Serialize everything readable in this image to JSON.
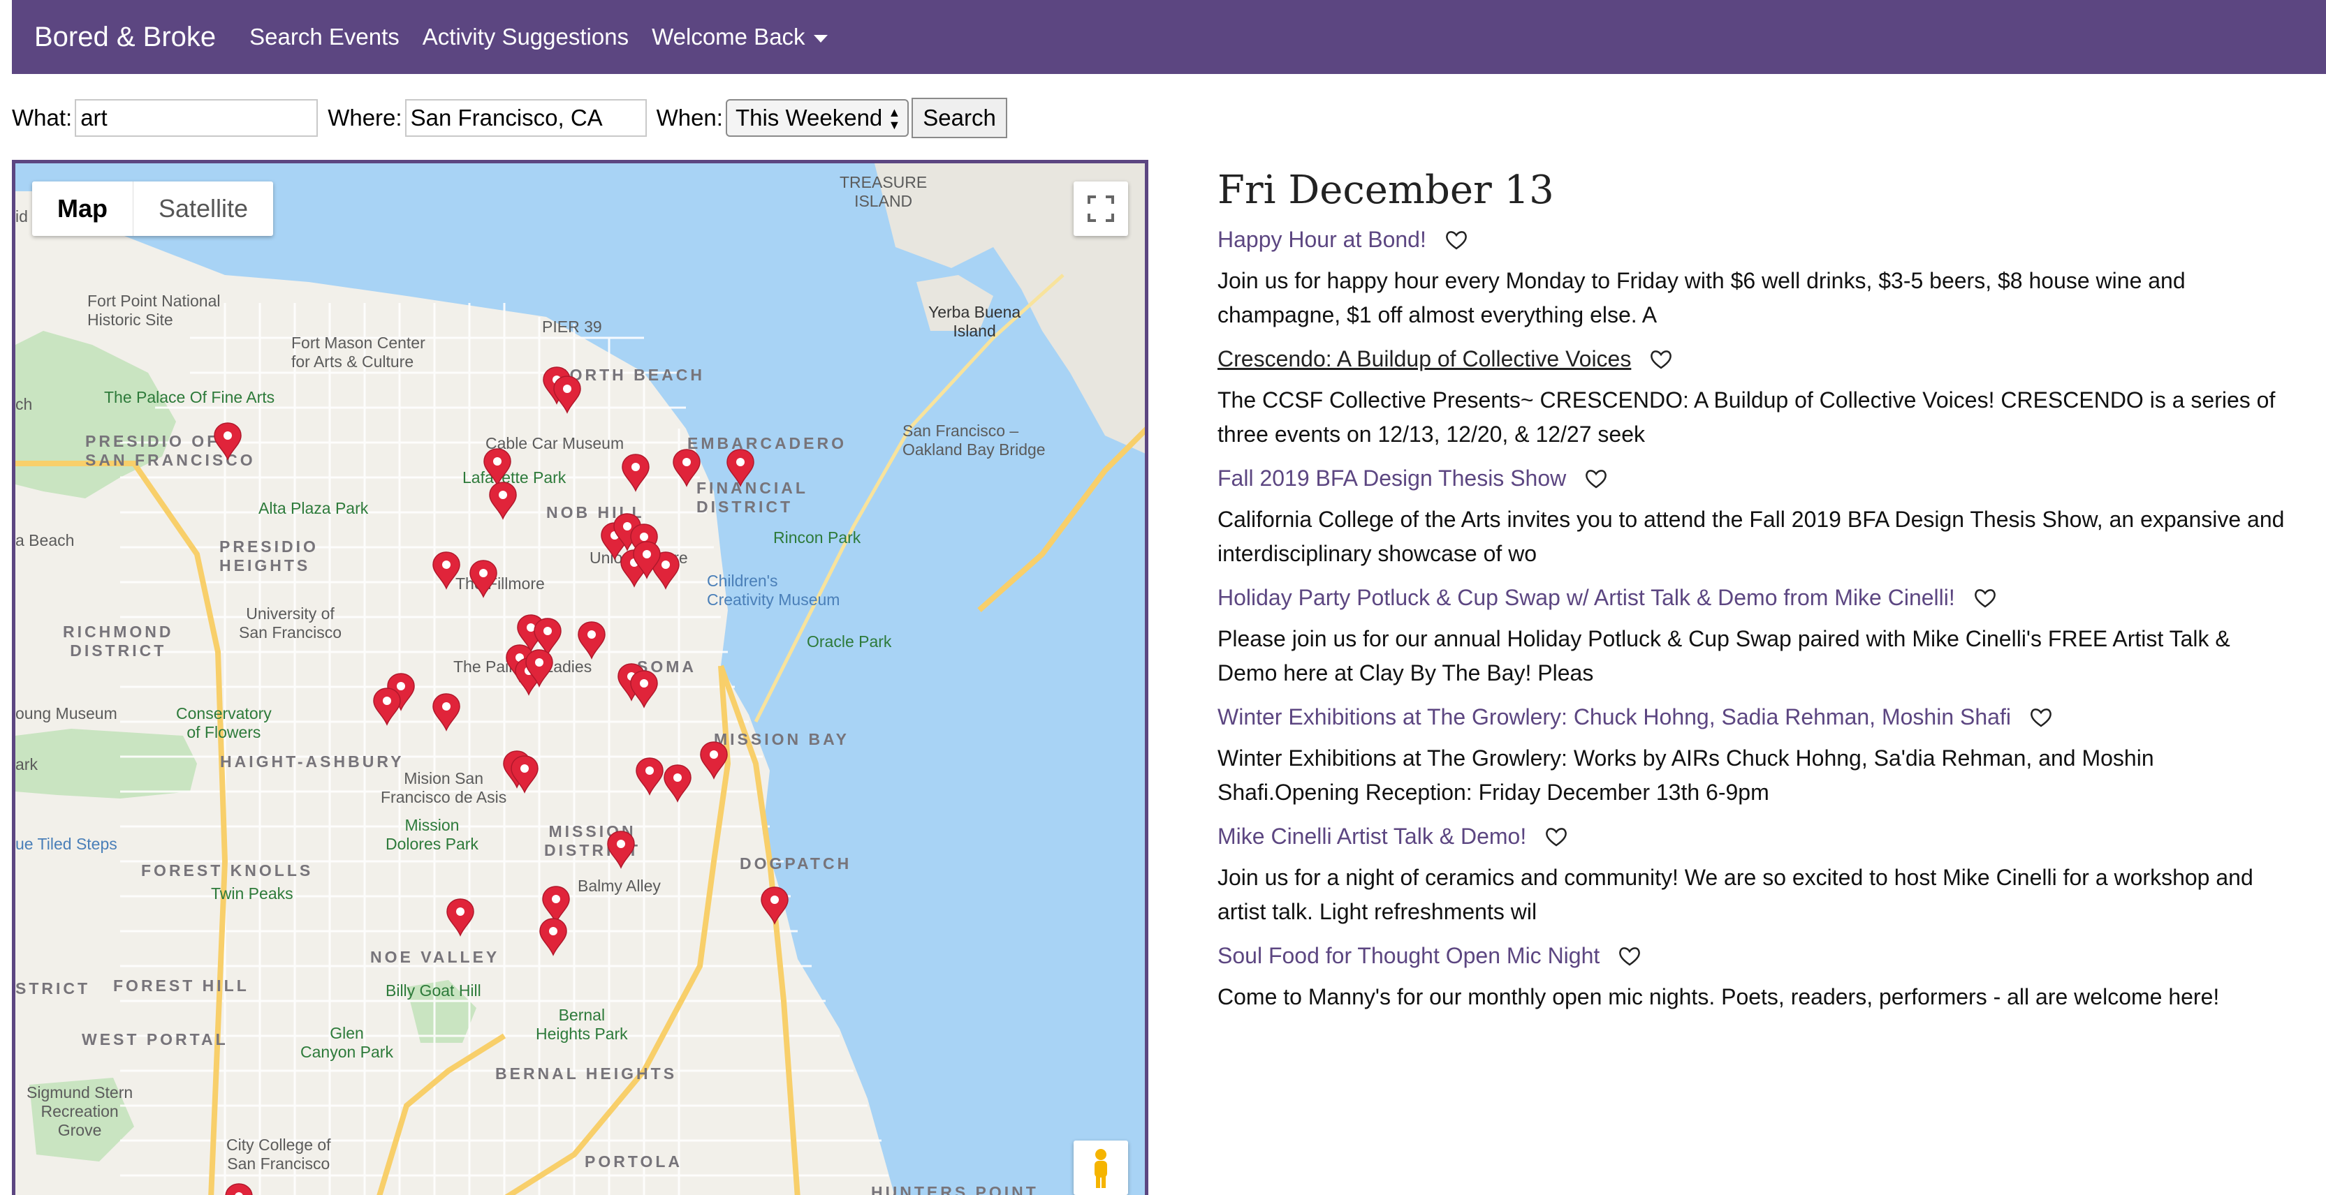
{
  "navbar": {
    "brand": "Bored & Broke",
    "links": [
      "Search Events",
      "Activity Suggestions"
    ],
    "dropdown": "Welcome Back"
  },
  "search": {
    "what_label": "What:",
    "what_value": "art",
    "where_label": "Where:",
    "where_value": "San Francisco, CA",
    "when_label": "When:",
    "when_value": "This Weekend",
    "button": "Search"
  },
  "map": {
    "toggle_map": "Map",
    "toggle_satellite": "Satellite",
    "labels": {
      "treasure_island": "TREASURE\nISLAND",
      "fort_point": "Fort Point National\nHistoric Site",
      "fort_mason": "Fort Mason Center\nfor Arts & Culture",
      "pier39": "PIER 39",
      "yerba_buena": "Yerba Buena\nIsland",
      "north_beach": "NORTH BEACH",
      "palace": "The Palace Of Fine Arts",
      "presidio": "PRESIDIO OF\nSAN FRANCISCO",
      "cable_car": "Cable Car Museum",
      "embarcadero": "EMBARCADERO",
      "bay_bridge": "San Francisco –\nOakland Bay Bridge",
      "lafayette": "Lafayette Park",
      "financial": "FINANCIAL\nDISTRICT",
      "nob_hill": "NOB HILL",
      "alta_plaza": "Alta Plaza Park",
      "rincon": "Rincon Park",
      "presidio_heights": "PRESIDIO\nHEIGHTS",
      "union_square": "Union Square",
      "fillmore": "The Fillmore",
      "childrens": "Children's\nCreativity Museum",
      "usf": "University of\nSan Francisco",
      "richmond": "RICHMOND\nDISTRICT",
      "oracle": "Oracle Park",
      "painted": "The Painted Ladies",
      "soma": "SOMA",
      "conservatory": "Conservatory\nof Flowers",
      "young": "oung Museum",
      "mission_bay": "MISSION BAY",
      "haight": "HAIGHT-ASHBURY",
      "mision_park": "Mision San\nFrancisco de Asis",
      "mission_dolores": "Mission\nDolores Park",
      "mission_district": "MISSION\nDISTRICT",
      "dogpatch": "DOGPATCH",
      "tiled": "ue Tiled Steps",
      "forest_knolls": "FOREST KNOLLS",
      "twin_peaks": "Twin Peaks",
      "balmy": "Balmy Alley",
      "noe": "NOE VALLEY",
      "forest_hill": "FOREST HILL",
      "billy_goat": "Billy Goat Hill",
      "bernal_park": "Bernal\nHeights Park",
      "west_portal": "WEST PORTAL",
      "glen": "Glen\nCanyon Park",
      "bernal": "BERNAL HEIGHTS",
      "sigmund": "Sigmund Stern\nRecreation\nGrove",
      "ccsf": "City College of\nSan Francisco",
      "portola": "PORTOLA",
      "hunters": "HUNTERS POINT",
      "beach": "a Beach",
      "strict": "STRICT",
      "ch": "ch",
      "ark": "ark",
      "id": "id"
    }
  },
  "events": {
    "day_heading": "Fri December 13",
    "items": [
      {
        "title": "Happy Hour at Bond!",
        "desc": "Join us for happy hour every Monday to Friday with $6 well drinks, $3-5 beers, $8 house wine and champagne, $1 off almost everything else. A"
      },
      {
        "title": "Crescendo: A Buildup of Collective Voices",
        "desc": "The CCSF Collective Presents~ CRESCENDO: A Buildup of Collective Voices! CRESCENDO is a series of three events on 12/13, 12/20, & 12/27 seek"
      },
      {
        "title": "Fall 2019 BFA Design Thesis Show",
        "desc": "California College of the Arts invites you to attend the Fall 2019 BFA Design Thesis Show, an expansive and interdisciplinary showcase of wo"
      },
      {
        "title": "Holiday Party Potluck & Cup Swap w/ Artist Talk & Demo from Mike Cinelli!",
        "desc": "Please join us for our annual Holiday Potluck & Cup Swap paired with Mike Cinelli's FREE Artist Talk & Demo here at Clay By The Bay!   Pleas"
      },
      {
        "title": "Winter Exhibitions at The Growlery: Chuck Hohng, Sadia Rehman, Moshin Shafi",
        "desc": "Winter Exhibitions at The Growlery: Works by AIRs Chuck Hohng, Sa'dia Rehman, and Moshin Shafi.Opening Reception: Friday December 13th 6-9pm"
      },
      {
        "title": "Mike Cinelli Artist Talk & Demo!",
        "desc": "Join us for a night of ceramics and community! We are so excited to host Mike Cinelli for a workshop and artist talk. Light refreshments wil"
      },
      {
        "title": "Soul Food for Thought Open Mic Night",
        "desc": "Come to Manny's for our monthly open mic nights. Poets, readers, performers - all are welcome here!"
      }
    ]
  }
}
